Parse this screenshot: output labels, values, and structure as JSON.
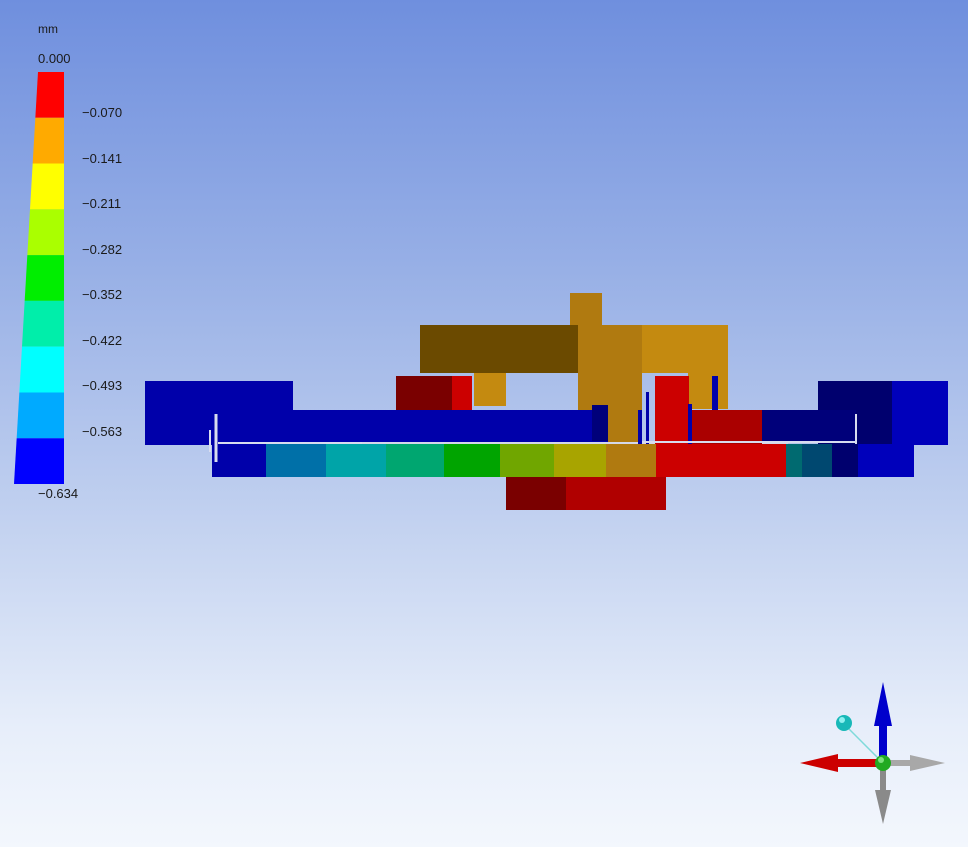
{
  "legend": {
    "unit": "mm",
    "labels": [
      "0.000",
      "-0.070",
      "-0.141",
      "-0.211",
      "-0.282",
      "-0.352",
      "-0.422",
      "-0.493",
      "-0.563",
      "-0.634"
    ],
    "colors": [
      "#ff0000",
      "#ffaa00",
      "#ffff00",
      "#aaff00",
      "#00ee00",
      "#00eeaa",
      "#00ffff",
      "#00aaff",
      "#0000ff"
    ]
  },
  "triad": {
    "axis_colors": {
      "vertical": "#0000cc",
      "left": "#cc0000",
      "right": "#a0a0a0",
      "down": "#8a8a8a",
      "iso_ball": "#18b8b8",
      "origin": "#22aa22"
    }
  }
}
